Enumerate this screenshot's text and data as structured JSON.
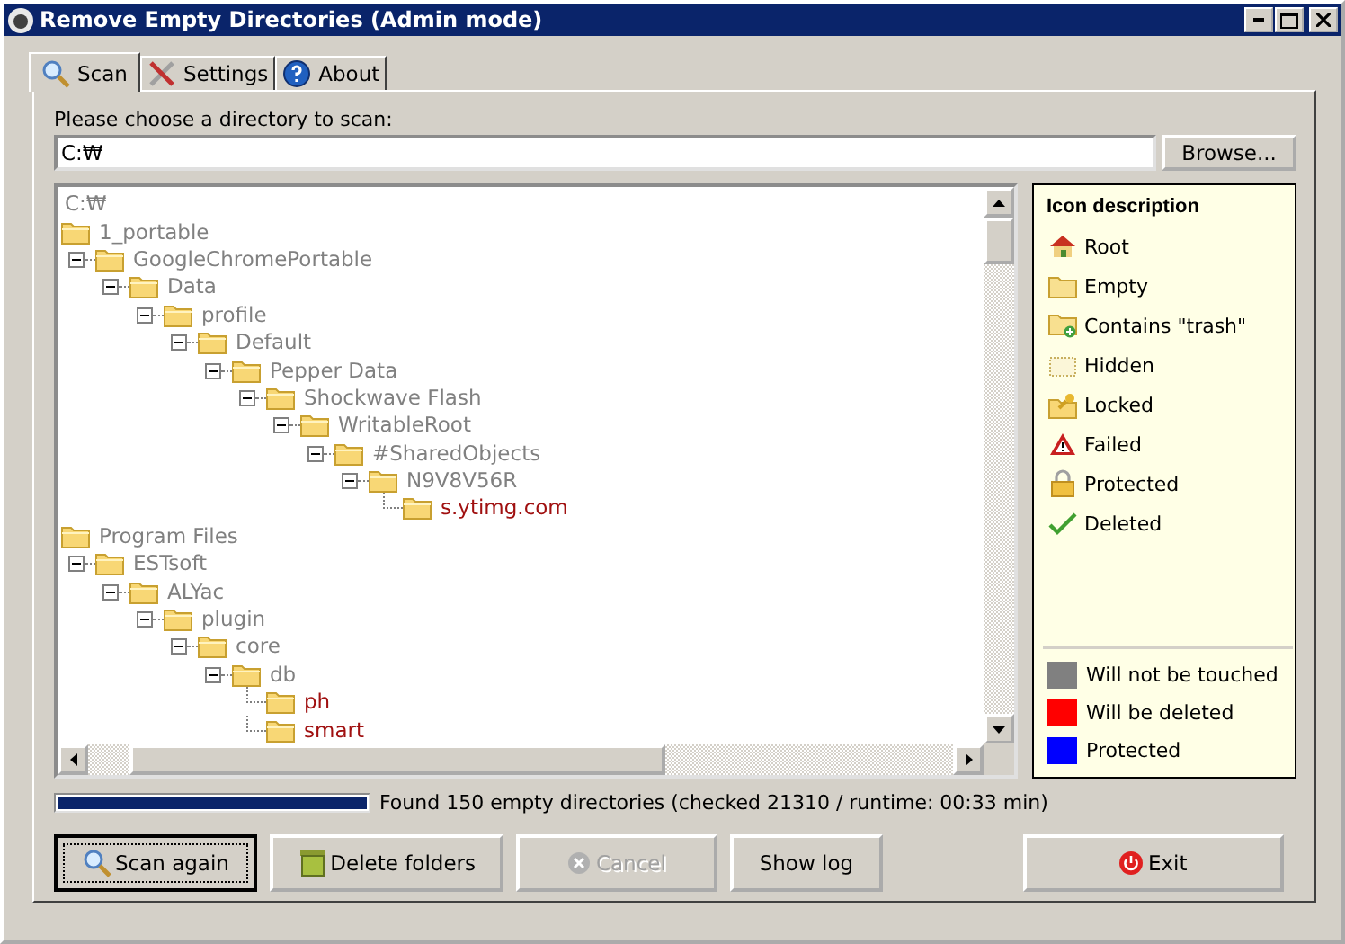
{
  "window": {
    "title": "Remove Empty Directories (Admin mode)"
  },
  "tabs": [
    {
      "label": "Scan",
      "kind": "scan",
      "selected": true
    },
    {
      "label": "Settings",
      "kind": "settings",
      "selected": false
    },
    {
      "label": "About",
      "kind": "about",
      "selected": false
    }
  ],
  "directory": {
    "label": "Please choose a directory to scan:",
    "value": "C:₩",
    "browse": "Browse..."
  },
  "tree": {
    "root": "C:₩",
    "nodes": [
      {
        "label": "1_portable",
        "color": "#808080",
        "children": [
          {
            "label": "GoogleChromePortable",
            "color": "#808080",
            "expanded": true,
            "children": [
              {
                "label": "Data",
                "color": "#808080",
                "expanded": true,
                "children": [
                  {
                    "label": "profile",
                    "color": "#808080",
                    "expanded": true,
                    "children": [
                      {
                        "label": "Default",
                        "color": "#808080",
                        "expanded": true,
                        "children": [
                          {
                            "label": "Pepper Data",
                            "color": "#808080",
                            "expanded": true,
                            "children": [
                              {
                                "label": "Shockwave Flash",
                                "color": "#808080",
                                "expanded": true,
                                "children": [
                                  {
                                    "label": "WritableRoot",
                                    "color": "#808080",
                                    "expanded": true,
                                    "children": [
                                      {
                                        "label": "#SharedObjects",
                                        "color": "#808080",
                                        "expanded": true,
                                        "children": [
                                          {
                                            "label": "N9V8V56R",
                                            "color": "#808080",
                                            "expanded": true,
                                            "children": [
                                              {
                                                "label": "s.ytimg.com",
                                                "color": "#a01010"
                                              }
                                            ]
                                          }
                                        ]
                                      }
                                    ]
                                  }
                                ]
                              }
                            ]
                          }
                        ]
                      }
                    ]
                  }
                ]
              }
            ]
          }
        ]
      },
      {
        "label": "Program Files",
        "color": "#808080",
        "children": [
          {
            "label": "ESTsoft",
            "color": "#808080",
            "expanded": true,
            "children": [
              {
                "label": "ALYac",
                "color": "#808080",
                "expanded": true,
                "children": [
                  {
                    "label": "plugin",
                    "color": "#808080",
                    "expanded": true,
                    "children": [
                      {
                        "label": "core",
                        "color": "#808080",
                        "expanded": true,
                        "children": [
                          {
                            "label": "db",
                            "color": "#808080",
                            "expanded": true,
                            "children": [
                              {
                                "label": "ph",
                                "color": "#a01010"
                              },
                              {
                                "label": "smart",
                                "color": "#a01010"
                              }
                            ]
                          }
                        ]
                      }
                    ]
                  }
                ]
              }
            ]
          }
        ]
      }
    ]
  },
  "legend": {
    "title": "Icon description",
    "icons": [
      {
        "label": "Root",
        "kind": "root"
      },
      {
        "label": "Empty",
        "kind": "empty"
      },
      {
        "label": "Contains \"trash\"",
        "kind": "trash"
      },
      {
        "label": "Hidden",
        "kind": "hidden"
      },
      {
        "label": "Locked",
        "kind": "locked"
      },
      {
        "label": "Failed",
        "kind": "failed"
      },
      {
        "label": "Protected",
        "kind": "protected"
      },
      {
        "label": "Deleted",
        "kind": "deleted"
      }
    ],
    "colors": [
      {
        "label": "Will not be touched",
        "color": "#808080"
      },
      {
        "label": "Will be deleted",
        "color": "#ff0000"
      },
      {
        "label": "Protected",
        "color": "#0000ff"
      }
    ]
  },
  "progress": {
    "level": 1,
    "text": "Found 150 empty directories (checked 21310 / runtime: 00:33 min)"
  },
  "buttons": [
    {
      "label": "Scan again",
      "kind": "scan",
      "disabled": false,
      "focused": true
    },
    {
      "label": "Delete folders",
      "kind": "delete",
      "disabled": false,
      "focused": false
    },
    {
      "label": "Cancel",
      "kind": "cancel",
      "disabled": true,
      "focused": false
    },
    {
      "label": "Show log",
      "kind": "log",
      "disabled": false,
      "focused": false
    },
    {
      "label": "Exit",
      "kind": "exit",
      "disabled": false,
      "focused": false
    }
  ]
}
